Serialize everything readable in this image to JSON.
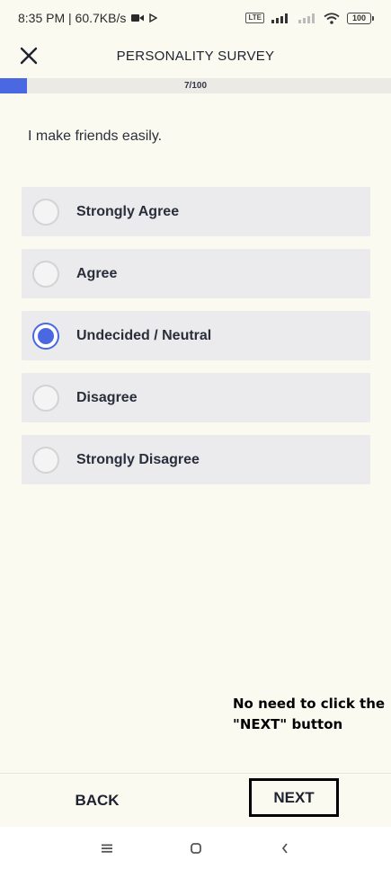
{
  "status_bar": {
    "time_speed": "8:35 PM | 60.7KB/s",
    "lte": "LTE",
    "battery": "100"
  },
  "header": {
    "title": "PERSONALITY SURVEY"
  },
  "progress": {
    "label": "7/100",
    "current": 7,
    "total": 100
  },
  "question": "I make friends easily.",
  "options": [
    {
      "label": "Strongly Agree",
      "selected": false
    },
    {
      "label": "Agree",
      "selected": false
    },
    {
      "label": "Undecided / Neutral",
      "selected": true
    },
    {
      "label": "Disagree",
      "selected": false
    },
    {
      "label": "Strongly Disagree",
      "selected": false
    }
  ],
  "note": "No need to click the \"NEXT\" button",
  "footer": {
    "back_label": "BACK",
    "next_label": "NEXT"
  },
  "colors": {
    "accent": "#4a68e1",
    "background": "#fbfaf1",
    "option_bg": "#ebebed"
  },
  "icons": {
    "close": "close-icon",
    "video": "video-camera-icon",
    "play": "play-icon",
    "signal": "signal-icon",
    "wifi": "wifi-icon",
    "battery": "battery-icon",
    "menu": "menu-icon",
    "home": "home-icon",
    "back": "back-icon"
  }
}
